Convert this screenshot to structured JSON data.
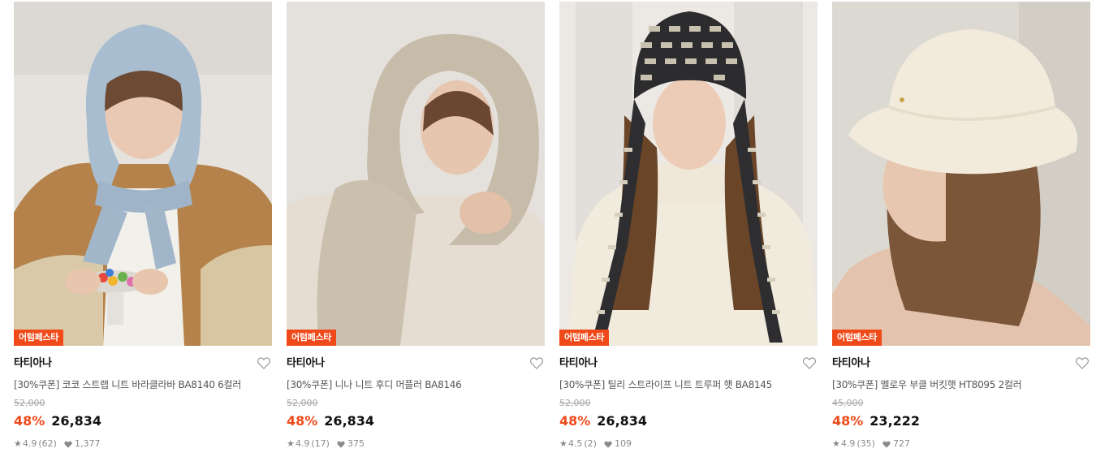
{
  "colors": {
    "accent": "#f04a1a",
    "text": "#111111",
    "muted": "#8a8a8a"
  },
  "products": [
    {
      "badge": "어텀페스타",
      "brand": "타티아나",
      "title": "[30%쿠폰] 코코 스트랩 니트 바라클라바 BA8140 6컬러",
      "original_price": "52,000",
      "discount": "48%",
      "price": "26,834",
      "rating": "4.9",
      "review_count": "(62)",
      "likes": "1,377",
      "icon": "heart-outline-icon"
    },
    {
      "badge": "어텀페스타",
      "brand": "타티아나",
      "title": "[30%쿠폰] 니나 니트 후디 머플러 BA8146",
      "original_price": "52,000",
      "discount": "48%",
      "price": "26,834",
      "rating": "4.9",
      "review_count": "(17)",
      "likes": "375",
      "icon": "heart-outline-icon"
    },
    {
      "badge": "어텀페스타",
      "brand": "타티아나",
      "title": "[30%쿠폰] 틸리 스트라이프 니트 트루퍼 햇 BA8145",
      "original_price": "52,000",
      "discount": "48%",
      "price": "26,834",
      "rating": "4.5",
      "review_count": "(2)",
      "likes": "109",
      "icon": "heart-outline-icon"
    },
    {
      "badge": "어텀페스타",
      "brand": "타티아나",
      "title": "[30%쿠폰] 멜로우 부클 버킷햇 HT8095 2컬러",
      "original_price": "45,000",
      "discount": "48%",
      "price": "23,222",
      "rating": "4.9",
      "review_count": "(35)",
      "likes": "727",
      "icon": "heart-outline-icon"
    }
  ]
}
